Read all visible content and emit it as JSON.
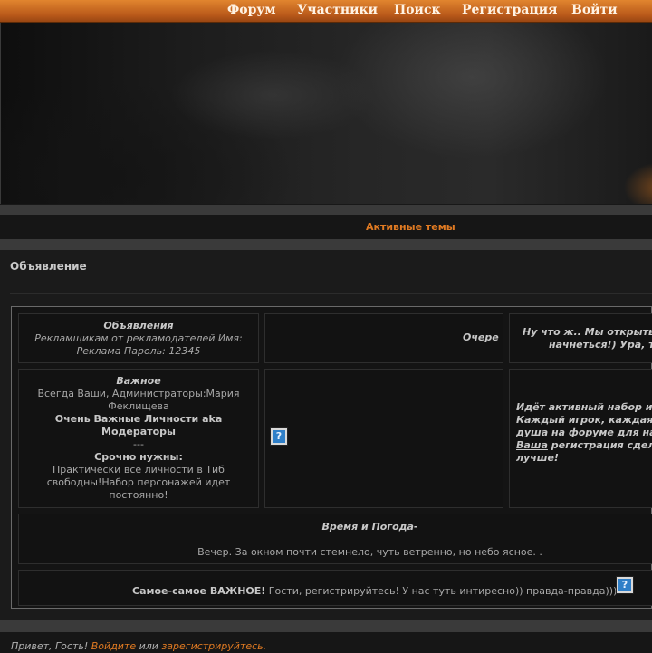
{
  "nav": {
    "items": [
      {
        "label": "Форум"
      },
      {
        "label": "Участники"
      },
      {
        "label": "Поиск"
      },
      {
        "label": "Регистрация"
      },
      {
        "label": "Войти"
      }
    ]
  },
  "active_topics": {
    "label": "Активные темы"
  },
  "announcement": {
    "heading": "Объявление",
    "ads": {
      "title": "Объявления",
      "line1": "Рекламщикам от рекламодателей Имя:",
      "line2": "Реклама Пароль: 12345"
    },
    "queue": {
      "label": "Очере"
    },
    "welcome": {
      "line1": "Ну что ж.. Мы открыть",
      "line2": "начнеться!) Ура, т"
    },
    "important": {
      "title": "Важное",
      "line1": "Всегда Ваши, Администраторы:Мария",
      "line2": "Феклищева",
      "line3": "Очень Важные Личности aka",
      "line4": "Модераторы",
      "line5": "---",
      "line6": "Срочно нужны:",
      "line7": "Практически все личности в Тиб",
      "line8": "свободны!Набор персонажей идет",
      "line9": "постоянно!"
    },
    "recruit": {
      "line1": "Идёт активный набор и",
      "line2": "Каждый игрок, каждая",
      "line3": "душа на форуме для на",
      "line4_link": "Ваша",
      "line4_rest": " регистрация сдел",
      "line5": "лучше!"
    },
    "weather": {
      "title": "Время и Погода-",
      "text": "Вечер. За окном почти стемнело, чуть ветренно, но небо ясное. ."
    },
    "most_important": {
      "bold": "Самое-самое ВАЖНОЕ!",
      "text": " Гости, регистрируйтесь! У нас туть интиресно)) правда-правда)))"
    }
  },
  "footer": {
    "greeting": "Привет, Гость! ",
    "login": "Войдите",
    "or": " или ",
    "register": "зарегистрируйтесь",
    "dot": "."
  }
}
